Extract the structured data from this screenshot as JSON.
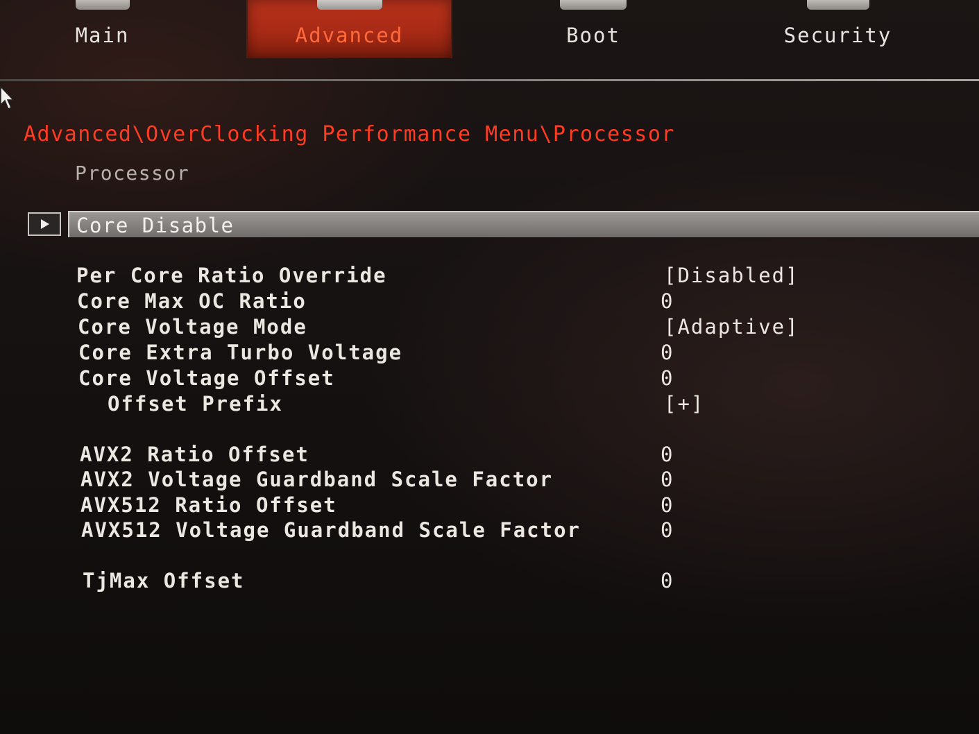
{
  "tabs": [
    {
      "label": "Main",
      "active": false,
      "icon": "main-icon"
    },
    {
      "label": "Advanced",
      "active": true,
      "icon": "advanced-icon"
    },
    {
      "label": "Boot",
      "active": false,
      "icon": "boot-icon"
    },
    {
      "label": "Security",
      "active": false,
      "icon": "security-icon"
    }
  ],
  "breadcrumb": "Advanced\\OverClocking Performance Menu\\Processor",
  "section_title": "Processor",
  "submenu": {
    "label": "Core Disable",
    "icon": "play-arrow-icon"
  },
  "settings": [
    {
      "label": "Per Core Ratio Override",
      "value": "[Disabled]"
    },
    {
      "label": "Core Max OC Ratio",
      "value": "0"
    },
    {
      "label": "Core Voltage Mode",
      "value": "[Adaptive]"
    },
    {
      "label": "Core Extra Turbo Voltage",
      "value": "0"
    },
    {
      "label": "Core Voltage Offset",
      "value": "0"
    },
    {
      "label": "Offset Prefix",
      "value": "[+]"
    },
    {
      "label": "AVX2 Ratio Offset",
      "value": "0"
    },
    {
      "label": "AVX2 Voltage Guardband Scale Factor",
      "value": "0"
    },
    {
      "label": "AVX512 Ratio Offset",
      "value": "0"
    },
    {
      "label": "AVX512 Voltage Guardband Scale Factor",
      "value": "0"
    },
    {
      "label": "TjMax Offset",
      "value": "0"
    }
  ],
  "colors": {
    "accent": "#ff3b22",
    "active_tab": "#b8321c",
    "text": "#ece7e1"
  }
}
